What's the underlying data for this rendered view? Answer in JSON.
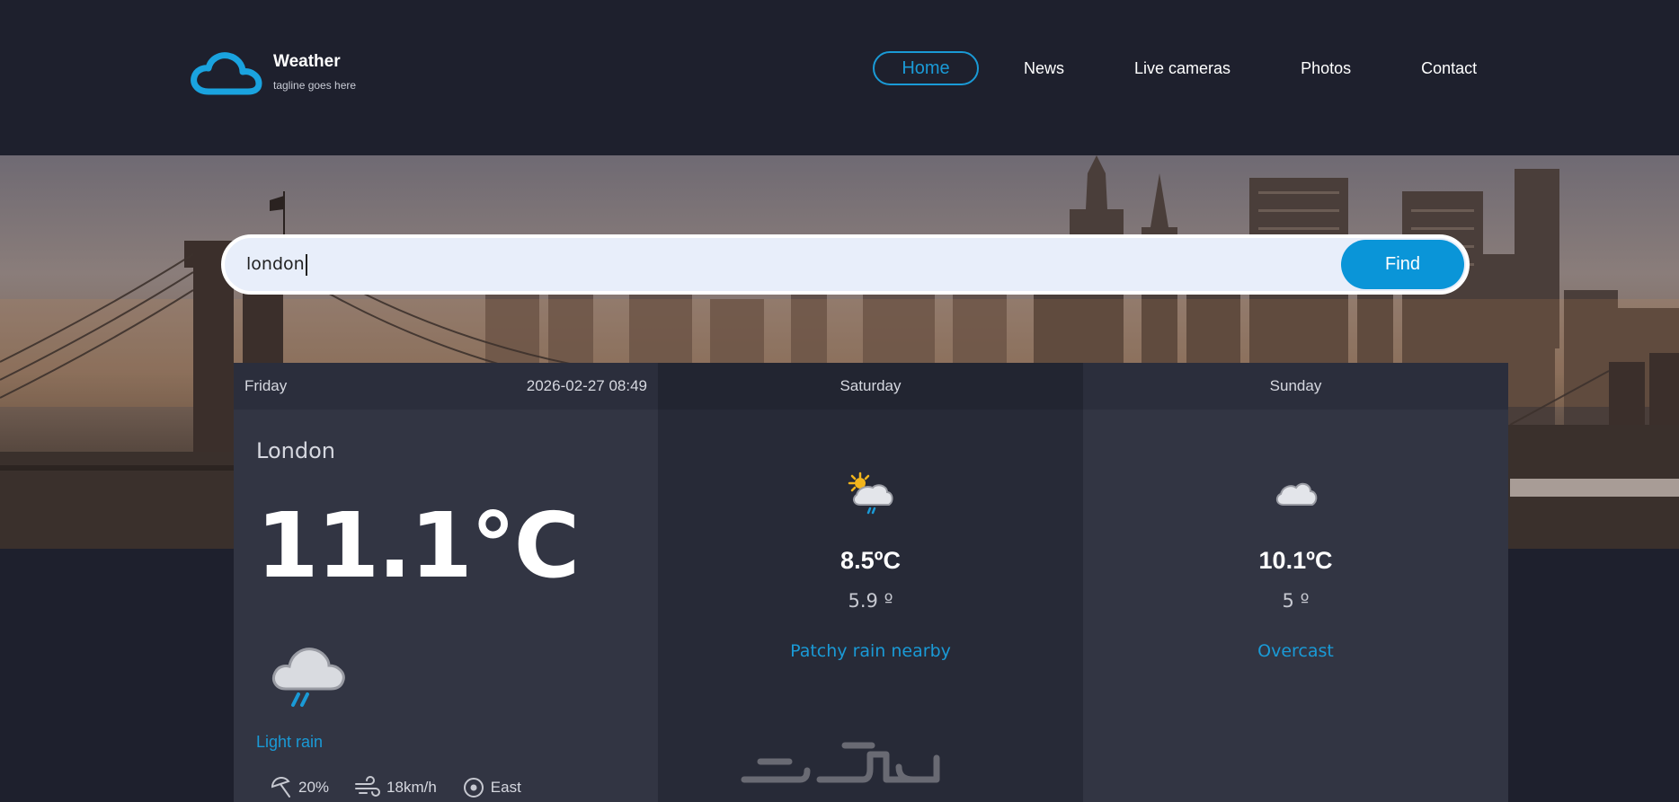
{
  "brand": {
    "title": "Weather",
    "tagline": "tagline goes here",
    "icon": "cloud-logo-icon"
  },
  "nav": {
    "items": [
      {
        "label": "Home",
        "active": true
      },
      {
        "label": "News",
        "active": false
      },
      {
        "label": "Live cameras",
        "active": false
      },
      {
        "label": "Photos",
        "active": false
      },
      {
        "label": "Contact",
        "active": false
      }
    ]
  },
  "search": {
    "value": "london",
    "button_label": "Find"
  },
  "today": {
    "day": "Friday",
    "datetime": "2026-02-27 08:49",
    "location": "London",
    "temperature": "11.1°C",
    "condition": "Light rain",
    "icon": "rain-cloud-icon",
    "metrics": {
      "rain": "20%",
      "wind": "18km/h",
      "direction": "East"
    }
  },
  "forecast": [
    {
      "day": "Saturday",
      "max": "8.5ºC",
      "min": "5.9 º",
      "condition": "Patchy rain nearby",
      "icon": "sun-cloud-rain-icon"
    },
    {
      "day": "Sunday",
      "max": "10.1ºC",
      "min": "5 º",
      "condition": "Overcast",
      "icon": "cloud-icon"
    }
  ],
  "colors": {
    "accent": "#1a9ad6",
    "background": "#1e202d",
    "panel": "#323543"
  }
}
